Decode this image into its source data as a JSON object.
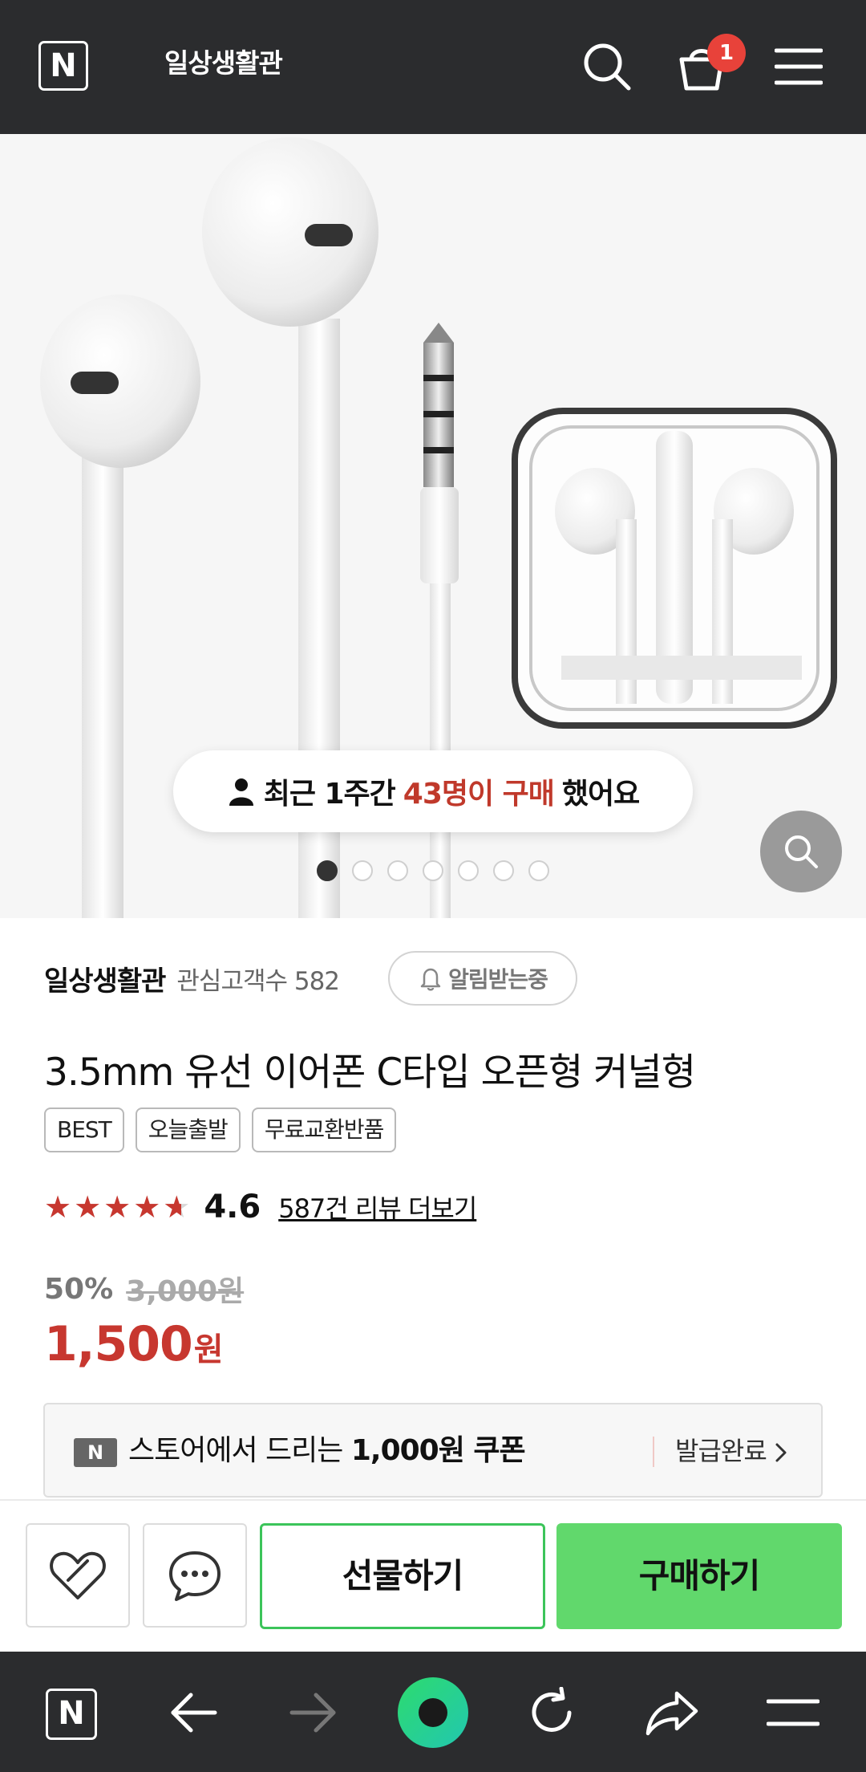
{
  "header": {
    "logo": "N",
    "store_name": "일상생활관",
    "cart_count": "1",
    "icons": [
      "search-icon",
      "cart-icon",
      "menu-icon"
    ]
  },
  "hero": {
    "toast_prefix": "최근 1주간",
    "toast_highlight": "43명이 구매",
    "toast_suffix": "했어요",
    "carousel": {
      "total": 7,
      "active": 1
    },
    "zoom_icon": "zoom-icon"
  },
  "seller": {
    "name": "일상생활관",
    "follower_text": "관심고객수 582",
    "notify_label": "알림받는중"
  },
  "product": {
    "title": "3.5mm 유선 이어폰 C타입 오픈형 커널형",
    "tags": [
      "BEST",
      "오늘출발",
      "무료교환반품"
    ],
    "rating": 4.6,
    "rating_text": "4.6",
    "review_link": "587건 리뷰 더보기",
    "discount": "50%",
    "original_price": "3,000원",
    "price": "1,500",
    "price_unit": "원"
  },
  "coupon": {
    "badge": "N",
    "text_pre": "스토어에서 드리는",
    "text_bold": "1,000원 쿠폰",
    "status": "발급완료"
  },
  "actions": {
    "gift_label": "선물하기",
    "buy_label": "구매하기",
    "icons": [
      "wishlist-icon",
      "talk-icon"
    ]
  },
  "colors": {
    "dark_bar": "#2b2c2e",
    "accent_red": "#c7372f",
    "buy_green": "#61d86c",
    "gift_border": "#3cc45a",
    "badge_red": "#e8423a"
  },
  "bottom_nav": {
    "logo": "N",
    "icons": [
      "n-home-icon",
      "back-icon",
      "forward-icon",
      "green-dot-icon",
      "refresh-icon",
      "share-icon",
      "menu-icon"
    ]
  }
}
